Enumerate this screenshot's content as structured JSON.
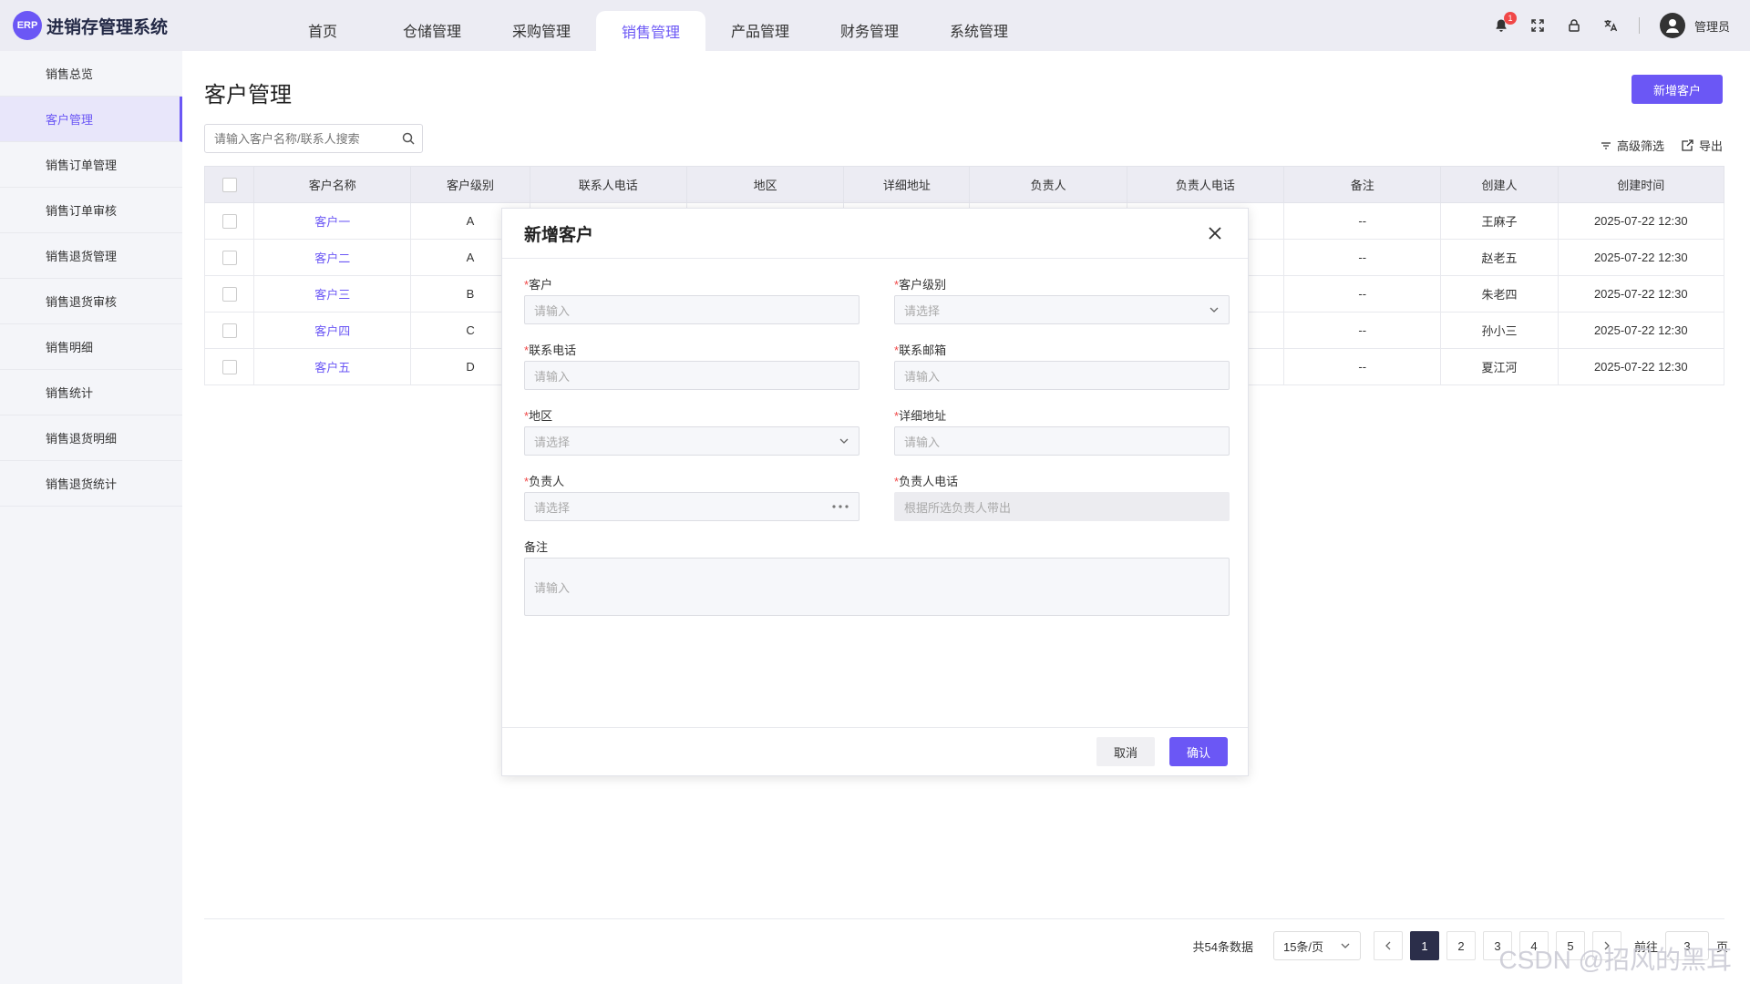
{
  "app": {
    "logo_badge": "ERP",
    "title": "进销存管理系统"
  },
  "nav": [
    "首页",
    "仓储管理",
    "采购管理",
    "销售管理",
    "产品管理",
    "财务管理",
    "系统管理"
  ],
  "nav_active_index": 3,
  "header": {
    "notification_count": "1",
    "user_name": "管理员"
  },
  "sidebar": {
    "items": [
      "销售总览",
      "客户管理",
      "销售订单管理",
      "销售订单审核",
      "销售退货管理",
      "销售退货审核",
      "销售明细",
      "销售统计",
      "销售退货明细",
      "销售退货统计"
    ],
    "active_index": 1
  },
  "page": {
    "title": "客户管理",
    "add_button": "新增客户",
    "search_placeholder": "请输入客户名称/联系人搜索",
    "filter_label": "高级筛选",
    "export_label": "导出"
  },
  "table": {
    "columns": [
      "客户名称",
      "客户级别",
      "联系人电话",
      "地区",
      "详细地址",
      "负责人",
      "负责人电话",
      "备注",
      "创建人",
      "创建时间"
    ],
    "rows": [
      {
        "name": "客户一",
        "level": "A",
        "remark": "--",
        "creator": "王麻子",
        "time": "2025-07-22 12:30"
      },
      {
        "name": "客户二",
        "level": "A",
        "remark": "--",
        "creator": "赵老五",
        "time": "2025-07-22 12:30"
      },
      {
        "name": "客户三",
        "level": "B",
        "remark": "--",
        "creator": "朱老四",
        "time": "2025-07-22 12:30"
      },
      {
        "name": "客户四",
        "level": "C",
        "remark": "--",
        "creator": "孙小三",
        "time": "2025-07-22 12:30"
      },
      {
        "name": "客户五",
        "level": "D",
        "remark": "--",
        "creator": "夏江河",
        "time": "2025-07-22 12:30"
      }
    ]
  },
  "pagination": {
    "total": "共54条数据",
    "page_size": "15条/页",
    "pages": [
      "1",
      "2",
      "3",
      "4",
      "5"
    ],
    "current": "1",
    "goto_label": "前往",
    "goto_value": "3",
    "page_suffix": "页"
  },
  "modal": {
    "title": "新增客户",
    "fields": {
      "customer": {
        "label": "客户",
        "placeholder": "请输入"
      },
      "level": {
        "label": "客户级别",
        "placeholder": "请选择"
      },
      "phone": {
        "label": "联系电话",
        "placeholder": "请输入"
      },
      "email": {
        "label": "联系邮箱",
        "placeholder": "请输入"
      },
      "region": {
        "label": "地区",
        "placeholder": "请选择"
      },
      "address": {
        "label": "详细地址",
        "placeholder": "请输入"
      },
      "owner": {
        "label": "负责人",
        "placeholder": "请选择"
      },
      "owner_phone": {
        "label": "负责人电话",
        "placeholder": "根据所选负责人带出"
      },
      "remark": {
        "label": "备注",
        "placeholder": "请输入"
      }
    },
    "cancel": "取消",
    "confirm": "确认"
  },
  "watermark": "CSDN @招风的黑耳",
  "colors": {
    "accent": "#6b57f5",
    "topbar": "#ececf3",
    "required": "#f04747"
  }
}
